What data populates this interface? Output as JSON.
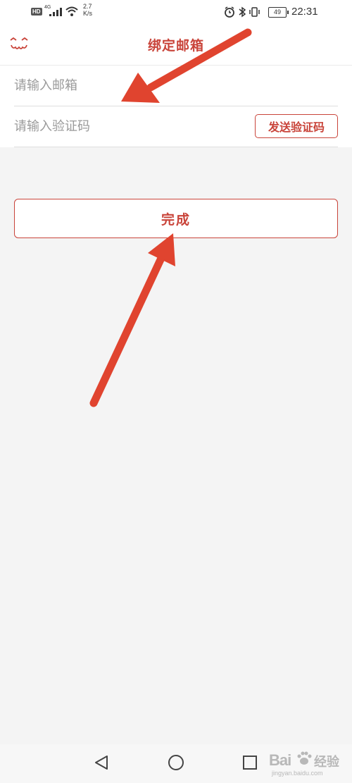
{
  "status_bar": {
    "hd": "HD",
    "network": "4G",
    "speed_value": "2.7",
    "speed_unit": "K/s",
    "battery": "49",
    "time": "22:31"
  },
  "header": {
    "title": "绑定邮箱",
    "back_icon": "back-face-icon"
  },
  "form": {
    "email_placeholder": "请输入邮箱",
    "email_value": "",
    "code_placeholder": "请输入验证码",
    "code_value": "",
    "send_code_label": "发送验证码"
  },
  "done_label": "完成",
  "colors": {
    "accent": "#c9443a",
    "annotation_arrow": "#e0442f",
    "background": "#f4f4f4"
  },
  "watermark": {
    "logo": "Bai",
    "text": "经验",
    "url": "jingyan.baidu.com"
  }
}
